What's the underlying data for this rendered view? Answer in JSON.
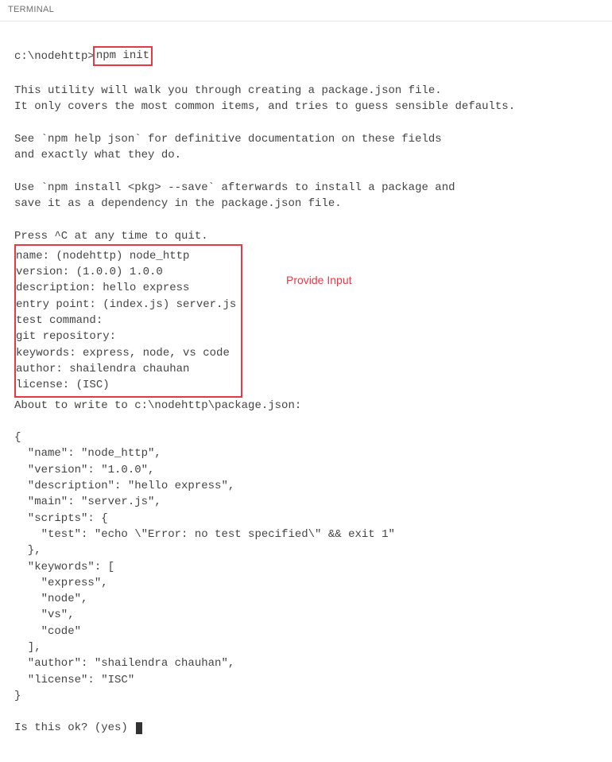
{
  "header": {
    "title": "TERMINAL"
  },
  "prompt": {
    "path": "c:\\nodehttp>",
    "command": "npm init"
  },
  "intro": {
    "line1": "This utility will walk you through creating a package.json file.",
    "line2": "It only covers the most common items, and tries to guess sensible defaults.",
    "line3": "See `npm help json` for definitive documentation on these fields",
    "line4": "and exactly what they do.",
    "line5": "Use `npm install <pkg> --save` afterwards to install a package and",
    "line6": "save it as a dependency in the package.json file.",
    "line7": "Press ^C at any time to quit."
  },
  "inputs": {
    "name": "name: (nodehttp) node_http",
    "version": "version: (1.0.0) 1.0.0",
    "description": "description: hello express",
    "entry": "entry point: (index.js) server.js",
    "test": "test command:",
    "git": "git repository:",
    "keywords": "keywords: express, node, vs code",
    "author": "author: shailendra chauhan",
    "license": "license: (ISC)"
  },
  "annotation": "Provide Input",
  "about": "About to write to c:\\nodehttp\\package.json:",
  "json_output": "{\n  \"name\": \"node_http\",\n  \"version\": \"1.0.0\",\n  \"description\": \"hello express\",\n  \"main\": \"server.js\",\n  \"scripts\": {\n    \"test\": \"echo \\\"Error: no test specified\\\" && exit 1\"\n  },\n  \"keywords\": [\n    \"express\",\n    \"node\",\n    \"vs\",\n    \"code\"\n  ],\n  \"author\": \"shailendra chauhan\",\n  \"license\": \"ISC\"\n}",
  "confirm": "Is this ok? (yes) "
}
